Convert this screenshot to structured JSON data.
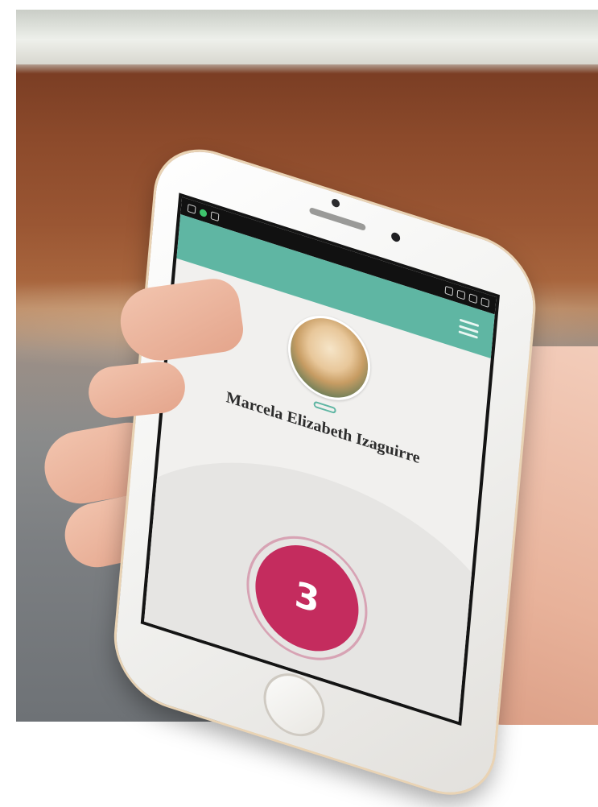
{
  "scene": {
    "description_color_table": "#8c4a2b",
    "description_color_accent": "#5fb6a3"
  },
  "status_bar": {
    "left_icons": [
      "notification-icon",
      "whatsapp-icon",
      "signal-icon"
    ],
    "right_icons": [
      "bluetooth-icon",
      "alarm-icon",
      "wifi-icon",
      "battery-icon"
    ]
  },
  "app_bar": {
    "title": "",
    "accent_color": "#5fb6a3"
  },
  "profile": {
    "badge": "",
    "name": "Marcela Elizabeth Izaguirre",
    "small_label": "",
    "phone": "",
    "age": ""
  },
  "alert": {
    "line1": "",
    "line2": "",
    "color": "#c42c5e"
  },
  "press_button": {
    "top_label": "",
    "count": "3",
    "bottom_label": ""
  }
}
